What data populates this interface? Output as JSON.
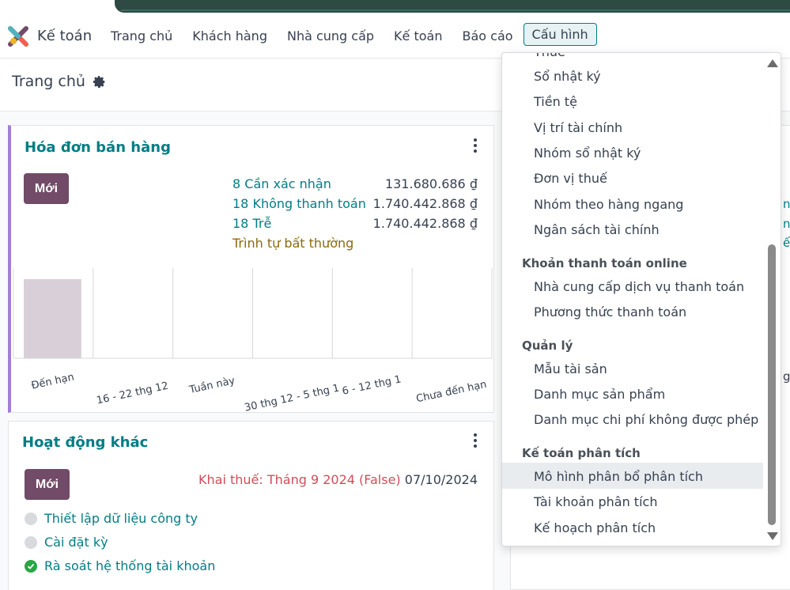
{
  "app": {
    "name": "Kế toán"
  },
  "nav": {
    "items": [
      "Trang chủ",
      "Khách hàng",
      "Nhà cung cấp",
      "Kế toán",
      "Báo cáo"
    ],
    "active": "Cấu hình"
  },
  "breadcrumb": {
    "title": "Trang chủ"
  },
  "sales_card": {
    "title": "Hóa đơn bán hàng",
    "new_label": "Mới",
    "stats": [
      {
        "label": "8 Cần xác nhận",
        "amount": "131.680.686 ₫"
      },
      {
        "label": "18 Không thanh toán",
        "amount": "1.740.442.868 ₫"
      },
      {
        "label": "18 Trễ",
        "amount": "1.740.442.868 ₫"
      }
    ],
    "warning_link": "Trình tự bất thường"
  },
  "chart_data": {
    "type": "bar",
    "categories": [
      "Đến hạn",
      "16 - 22 thg 12",
      "Tuần này",
      "30 thg 12 - 5 thg 1",
      "6 - 12 thg 1",
      "Chưa đến hạn"
    ],
    "values": [
      1,
      0,
      0,
      0,
      0,
      0
    ],
    "colors": {
      "bar": "#d9cfd8",
      "grid": "#d8d8d8"
    }
  },
  "activity_card": {
    "title": "Hoạt động khác",
    "new_label": "Mới",
    "warning": "Khai thuế: Tháng 9 2024 (False)",
    "date": "07/10/2024",
    "steps": [
      {
        "label": "Thiết lập dữ liệu công ty",
        "done": false
      },
      {
        "label": "Cài đặt kỳ",
        "done": false
      },
      {
        "label": "Rà soát hệ thống tài khoản",
        "done": true
      }
    ]
  },
  "dropdown": {
    "partial_top": "Thuế",
    "groups": [
      {
        "header": "",
        "items": [
          "Sổ nhật ký",
          "Tiền tệ",
          "Vị trí tài chính",
          "Nhóm sổ nhật ký",
          "Đơn vị thuế",
          "Nhóm theo hàng ngang",
          "Ngân sách tài chính"
        ]
      },
      {
        "header": "Khoản thanh toán online",
        "items": [
          "Nhà cung cấp dịch vụ thanh toán",
          "Phương thức thanh toán"
        ]
      },
      {
        "header": "Quản lý",
        "items": [
          "Mẫu tài sản",
          "Danh mục sản phẩm",
          "Danh mục chi phí không được phép"
        ]
      },
      {
        "header": "Kế toán phân tích",
        "items": [
          "Mô hình phân bổ phân tích",
          "Tài khoản phân tích",
          "Kế hoạch phân tích"
        ]
      }
    ],
    "hovered": "Mô hình phân bổ phân tích"
  },
  "colors": {
    "brand": "#714b67",
    "accent": "#017e84",
    "warning": "#d44c59"
  }
}
